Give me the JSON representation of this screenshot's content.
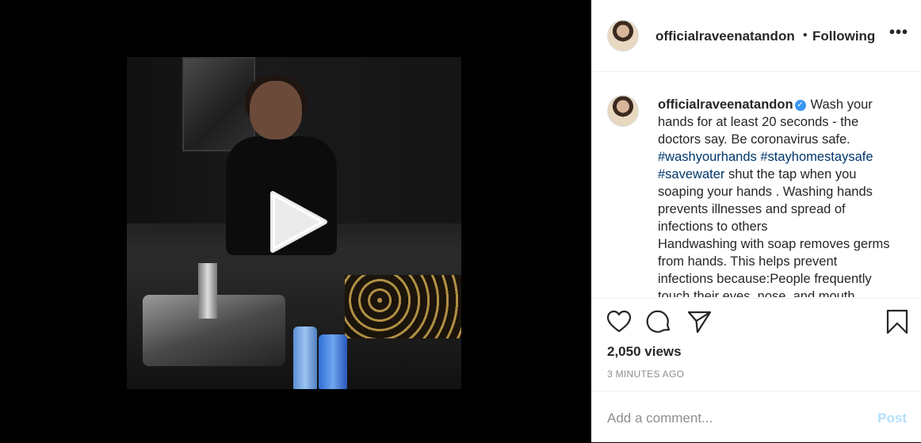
{
  "post": {
    "username": "officialraveenatandon",
    "follow_separator": "•",
    "follow_label": "Following",
    "more_label": "•••",
    "verified_badge": "✓",
    "caption_intro": "Wash your hands for at least 20 seconds - the doctors say. Be coronavirus safe.",
    "hashtags": [
      "#washyourhands",
      "#stayhomestaysafe",
      "#savewater"
    ],
    "caption_rest": "shut the tap when you soaping your hands . Washing hands prevents illnesses and spread of infections to others",
    "caption_more": "Handwashing with soap removes germs from hands. This helps prevent infections because:People frequently touch their eyes, nose, and mouth",
    "views": "2,050 views",
    "timestamp": "3 MINUTES AGO"
  },
  "comment": {
    "placeholder": "Add a comment...",
    "post_label": "Post"
  },
  "icons": {
    "like": "heart-icon",
    "comment": "speech-bubble-icon",
    "share": "paper-plane-icon",
    "save": "bookmark-icon",
    "play": "play-icon"
  },
  "colors": {
    "accent_link": "#00376b",
    "verified": "#3897f0",
    "post_button_disabled": "#b2dffc"
  }
}
